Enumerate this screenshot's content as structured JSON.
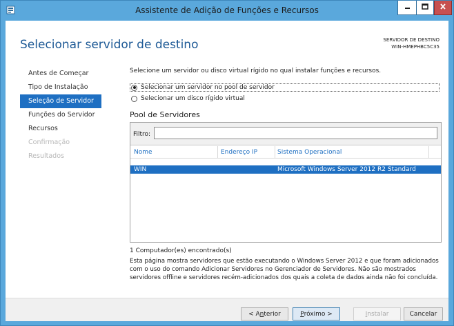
{
  "window": {
    "title": "Assistente de Adição de Funções e Recursos",
    "icon": "server-manager-icon",
    "close_color": "#c75050",
    "accent": "#1e6fc2"
  },
  "header": {
    "page_title": "Selecionar servidor de destino",
    "dest_label": "SERVIDOR DE DESTINO",
    "dest_name": "WIN-HMEPHBC5C35"
  },
  "nav": {
    "items": [
      {
        "label": "Antes de Começar",
        "state": "normal"
      },
      {
        "label": "Tipo de Instalação",
        "state": "normal"
      },
      {
        "label": "Seleção de Servidor",
        "state": "active"
      },
      {
        "label": "Funções do Servidor",
        "state": "normal"
      },
      {
        "label": "Recursos",
        "state": "normal"
      },
      {
        "label": "Confirmação",
        "state": "disabled"
      },
      {
        "label": "Resultados",
        "state": "disabled"
      }
    ]
  },
  "main": {
    "instruction": "Selecione um servidor ou disco virtual rígido no qual instalar funções e recursos.",
    "option_pool": "Selecionar um servidor no pool de servidor",
    "option_vhd": "Selecionar um disco rígido virtual",
    "pool_title": "Pool de Servidores",
    "filter_label": "Filtro:",
    "filter_value": "",
    "columns": [
      "Nome",
      "Endereço IP",
      "Sistema Operacional"
    ],
    "rows": [
      {
        "name": "WIN",
        "ip": "",
        "os": "Microsoft Windows Server 2012 R2 Standard"
      }
    ],
    "count_text": "1 Computador(es) encontrado(s)",
    "description": "Esta página mostra servidores que estão executando o Windows Server 2012 e que foram adicionados com o uso do comando Adicionar Servidores no Gerenciador de Servidores. Não são mostrados servidores offline e servidores recém-adicionados dos quais a coleta de dados ainda não foi concluída."
  },
  "footer": {
    "back_pre": "< A",
    "back_ul": "n",
    "back_post": "terior",
    "next_ul": "P",
    "next_post": "róximo >",
    "install_ul": "I",
    "install_post": "nstalar",
    "cancel": "Cancelar"
  }
}
